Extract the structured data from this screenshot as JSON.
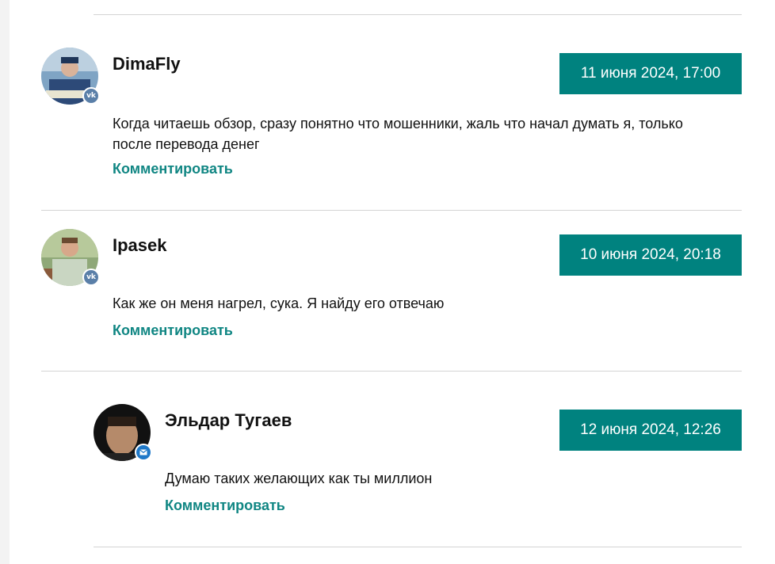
{
  "comments": [
    {
      "author": "DimaFly",
      "date": "11 июня 2024, 17:00",
      "text": "Когда читаешь обзор, сразу понятно что мошенники, жаль что начал думать я, только после перевода денег",
      "reply_label": "Комментировать",
      "badge": "vk-icon"
    },
    {
      "author": "Ipasek",
      "date": "10 июня 2024, 20:18",
      "text": "Как же он меня нагрел, сука. Я найду его отвечаю",
      "reply_label": "Комментировать",
      "badge": "vk-icon"
    },
    {
      "author": "Эльдар Тугаев",
      "date": "12 июня 2024, 12:26",
      "text": "Думаю таких желающих как ты миллион",
      "reply_label": "Комментировать",
      "badge": "mail-icon"
    }
  ],
  "colors": {
    "accent": "#00827f",
    "link": "#108683",
    "divider": "#d4d4d4",
    "vk_badge": "#5a7fa8",
    "mail_badge": "#1e78c8"
  }
}
